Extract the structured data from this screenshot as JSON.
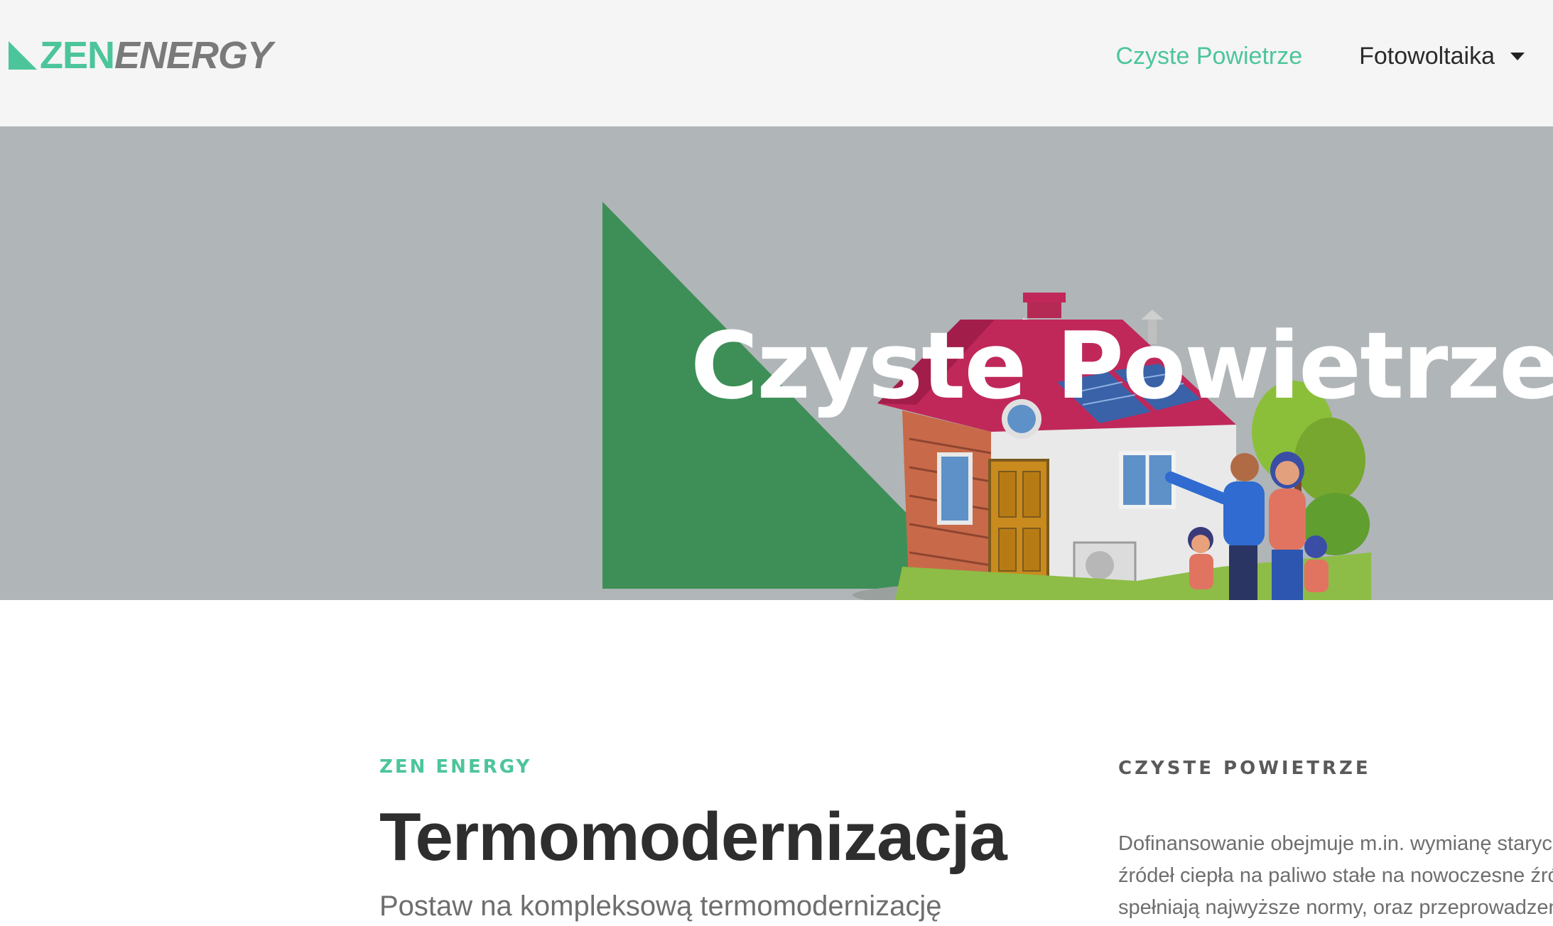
{
  "header": {
    "logo": {
      "part1": "ZEN",
      "part2": "ENERGY"
    },
    "nav": [
      {
        "label": "Czyste Powietrze",
        "active": true
      },
      {
        "label": "Fotowoltaika",
        "has_dropdown": true
      }
    ]
  },
  "hero": {
    "title": "Czyste Powietrze"
  },
  "main": {
    "eyebrow": "ZEN ENERGY",
    "heading": "Termomodernizacja",
    "subheading": "Postaw na kompleksową termomodernizację"
  },
  "sidebar": {
    "title": "CZYSTE POWIETRZE",
    "lines": [
      "Dofinansowanie obejmuje m.in. wymianę starych",
      "źródeł ciepła na paliwo stałe na nowoczesne źródła",
      "spełniają najwyższe normy, oraz przeprowadzenie"
    ]
  },
  "colors": {
    "accent": "#4cc59a",
    "hero_bg": "#b0b5b8",
    "triangle": "#3d8f57",
    "header_bg": "#f5f5f5"
  }
}
